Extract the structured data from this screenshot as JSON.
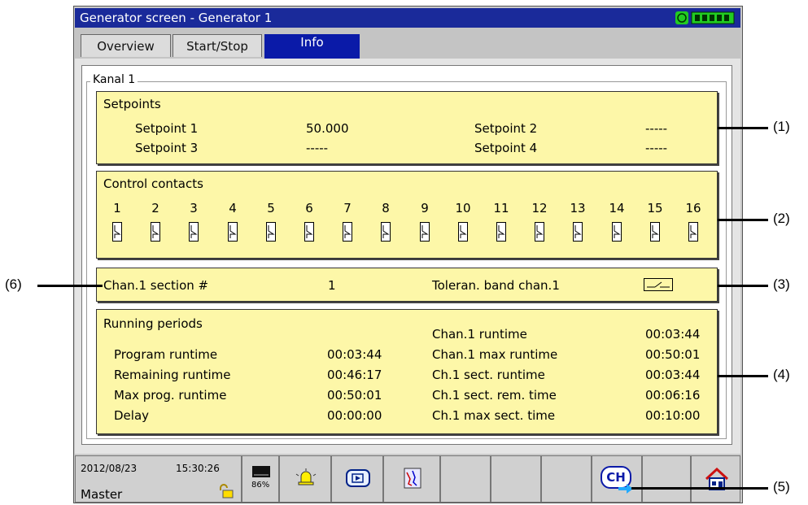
{
  "window": {
    "title": "Generator screen - Generator 1"
  },
  "tabs": [
    {
      "label": "Overview"
    },
    {
      "label": "Start/Stop"
    },
    {
      "label": "Info"
    }
  ],
  "group": {
    "label": "Kanal 1"
  },
  "setpoints": {
    "title": "Setpoints",
    "items": [
      {
        "label": "Setpoint 1",
        "value": "50.000"
      },
      {
        "label": "Setpoint 2",
        "value": "-----"
      },
      {
        "label": "Setpoint 3",
        "value": "-----"
      },
      {
        "label": "Setpoint 4",
        "value": "-----"
      }
    ]
  },
  "control_contacts": {
    "title": "Control contacts",
    "numbers": [
      "1",
      "2",
      "3",
      "4",
      "5",
      "6",
      "7",
      "8",
      "9",
      "10",
      "11",
      "12",
      "13",
      "14",
      "15",
      "16"
    ]
  },
  "section": {
    "label": "Chan.1 section #",
    "value": "1",
    "tolerance_label": "Toleran. band chan.1"
  },
  "running": {
    "title": "Running periods",
    "left": [
      {
        "label": "Program runtime",
        "value": "00:03:44"
      },
      {
        "label": "Remaining runtime",
        "value": "00:46:17"
      },
      {
        "label": "Max prog. runtime",
        "value": "00:50:01"
      },
      {
        "label": "Delay",
        "value": "00:00:00"
      }
    ],
    "right": [
      {
        "label": "Chan.1 runtime",
        "value": "00:03:44"
      },
      {
        "label": "Chan.1 max runtime",
        "value": "00:50:01"
      },
      {
        "label": "Ch.1 sect. runtime",
        "value": "00:03:44"
      },
      {
        "label": "Ch.1 sect. rem. time",
        "value": "00:06:16"
      },
      {
        "label": "Ch.1 max sect. time",
        "value": "00:10:00"
      }
    ]
  },
  "status": {
    "date": "2012/08/23",
    "time": "15:30:26",
    "user": "Master",
    "memory": "86%",
    "ch_button": "CH"
  },
  "callouts": [
    "(1)",
    "(2)",
    "(3)",
    "(4)",
    "(5)",
    "(6)"
  ],
  "colors": {
    "titlebar": "#1a2a9a",
    "active_tab": "#0a1aa8",
    "panel": "#fdf7a8",
    "status_icon": "#22cc22"
  }
}
